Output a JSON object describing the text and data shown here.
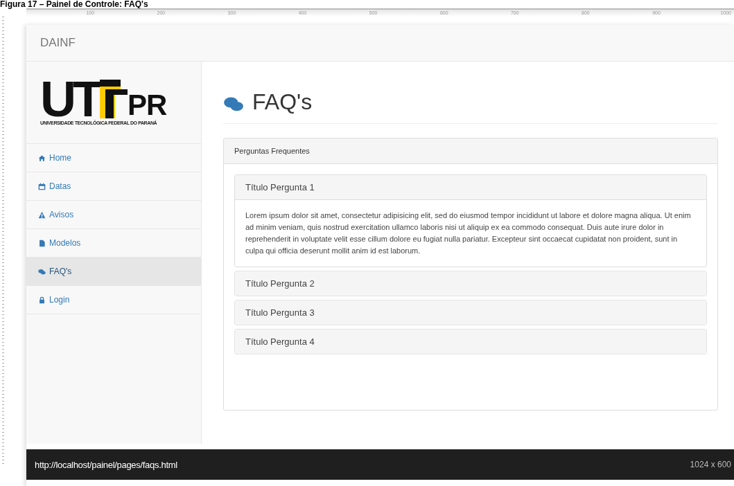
{
  "caption": "Figura 17 – Painel de Controle: FAQ's",
  "ruler": {
    "labels": [
      "100",
      "200",
      "300",
      "400",
      "500",
      "600",
      "700",
      "800",
      "900",
      "1000"
    ]
  },
  "navbar": {
    "brand": "DAINF"
  },
  "logo": {
    "left": "UT",
    "right": "PR",
    "subtitle": "UNIVERSIDADE TECNOLÓGICA FEDERAL DO PARANÁ"
  },
  "sidebar": {
    "items": [
      {
        "label": "Home",
        "selected": false
      },
      {
        "label": "Datas",
        "selected": false
      },
      {
        "label": "Avisos",
        "selected": false
      },
      {
        "label": "Modelos",
        "selected": false
      },
      {
        "label": "FAQ's",
        "selected": true
      },
      {
        "label": "Login",
        "selected": false
      }
    ]
  },
  "page": {
    "title": "FAQ's"
  },
  "panel": {
    "heading": "Perguntas Frequentes",
    "questions": [
      {
        "title": "Título Pergunta 1",
        "expanded": true,
        "answer": "Lorem ipsum dolor sit amet, consectetur adipisicing elit, sed do eiusmod tempor incididunt ut labore et dolore magna aliqua. Ut enim ad minim veniam, quis nostrud exercitation ullamco laboris nisi ut aliquip ex ea commodo consequat. Duis aute irure dolor in reprehenderit in voluptate velit esse cillum dolore eu fugiat nulla pariatur. Excepteur sint occaecat cupidatat non proident, sunt in culpa qui officia deserunt mollit anim id est laborum."
      },
      {
        "title": "Título Pergunta 2",
        "expanded": false
      },
      {
        "title": "Título Pergunta 3",
        "expanded": false
      },
      {
        "title": "Título Pergunta 4",
        "expanded": false
      }
    ]
  },
  "status_bar": {
    "url": "http://localhost/painel/pages/faqs.html",
    "size": "1024 x 600"
  }
}
